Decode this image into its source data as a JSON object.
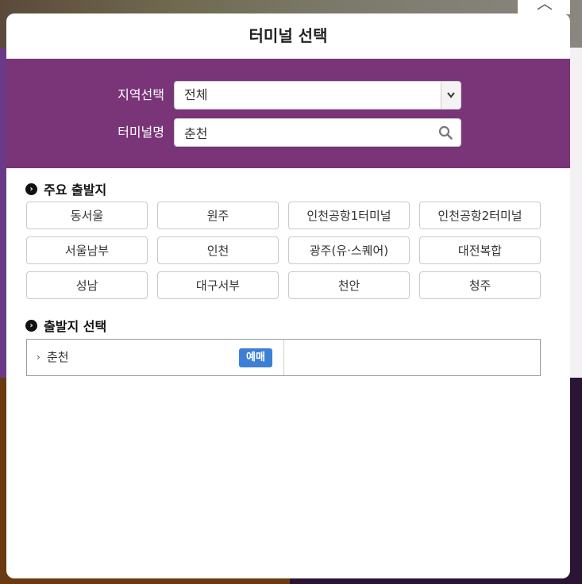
{
  "modal": {
    "title": "터미널 선택",
    "close_icon": "close-x-icon"
  },
  "search": {
    "region_label": "지역선택",
    "region_value": "전체",
    "terminal_label": "터미널명",
    "terminal_value": "춘천",
    "icons": {
      "dropdown": "chevron-down-icon",
      "search": "search-icon"
    }
  },
  "major": {
    "title": "주요 출발지",
    "terminals": [
      "동서울",
      "원주",
      "인천공항1터미널",
      "인천공항2터미널",
      "서울남부",
      "인천",
      "광주(유·스퀘어)",
      "대전복합",
      "성남",
      "대구서부",
      "천안",
      "청주"
    ]
  },
  "departure": {
    "title": "출발지 선택",
    "items": [
      {
        "name": "춘천",
        "badge": "예매"
      }
    ]
  },
  "colors": {
    "panel": "#7a3579",
    "badge": "#3d7fd6"
  }
}
